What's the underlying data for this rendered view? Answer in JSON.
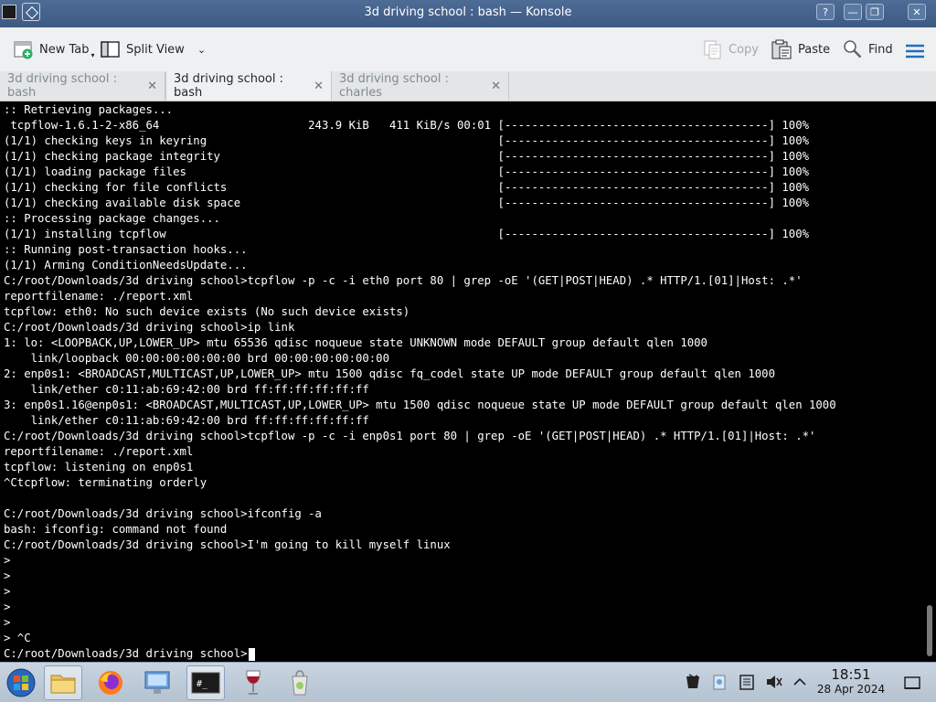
{
  "window": {
    "title": "3d driving school : bash — Konsole"
  },
  "toolbar": {
    "new_tab": "New Tab",
    "split_view": "Split View",
    "copy": "Copy",
    "paste": "Paste",
    "find": "Find"
  },
  "tabs": [
    {
      "label": "3d driving school : bash",
      "active": false
    },
    {
      "label": "3d driving school : bash",
      "active": true
    },
    {
      "label": "3d driving school : charles",
      "active": false
    }
  ],
  "terminal": {
    "lines": [
      ":: Retrieving packages...",
      " tcpflow-1.6.1-2-x86_64                      243.9 KiB   411 KiB/s 00:01 [---------------------------------------] 100%",
      "(1/1) checking keys in keyring                                           [---------------------------------------] 100%",
      "(1/1) checking package integrity                                         [---------------------------------------] 100%",
      "(1/1) loading package files                                              [---------------------------------------] 100%",
      "(1/1) checking for file conflicts                                        [---------------------------------------] 100%",
      "(1/1) checking available disk space                                      [---------------------------------------] 100%",
      ":: Processing package changes...",
      "(1/1) installing tcpflow                                                 [---------------------------------------] 100%",
      ":: Running post-transaction hooks...",
      "(1/1) Arming ConditionNeedsUpdate...",
      "C:/root/Downloads/3d driving school>tcpflow -p -c -i eth0 port 80 | grep -oE '(GET|POST|HEAD) .* HTTP/1.[01]|Host: .*'",
      "reportfilename: ./report.xml",
      "tcpflow: eth0: No such device exists (No such device exists)",
      "C:/root/Downloads/3d driving school>ip link",
      "1: lo: <LOOPBACK,UP,LOWER_UP> mtu 65536 qdisc noqueue state UNKNOWN mode DEFAULT group default qlen 1000",
      "    link/loopback 00:00:00:00:00:00 brd 00:00:00:00:00:00",
      "2: enp0s1: <BROADCAST,MULTICAST,UP,LOWER_UP> mtu 1500 qdisc fq_codel state UP mode DEFAULT group default qlen 1000",
      "    link/ether c0:11:ab:69:42:00 brd ff:ff:ff:ff:ff:ff",
      "3: enp0s1.16@enp0s1: <BROADCAST,MULTICAST,UP,LOWER_UP> mtu 1500 qdisc noqueue state UP mode DEFAULT group default qlen 1000",
      "    link/ether c0:11:ab:69:42:00 brd ff:ff:ff:ff:ff:ff",
      "C:/root/Downloads/3d driving school>tcpflow -p -c -i enp0s1 port 80 | grep -oE '(GET|POST|HEAD) .* HTTP/1.[01]|Host: .*'",
      "reportfilename: ./report.xml",
      "tcpflow: listening on enp0s1",
      "^Ctcpflow: terminating orderly",
      "",
      "C:/root/Downloads/3d driving school>ifconfig -a",
      "bash: ifconfig: command not found",
      "C:/root/Downloads/3d driving school>I'm going to kill myself linux",
      ">",
      ">",
      ">",
      ">",
      ">",
      "> ^C"
    ],
    "prompt": "C:/root/Downloads/3d driving school>"
  },
  "taskbar": {
    "apps": [
      "start-orb",
      "file-manager",
      "firefox",
      "system-settings",
      "terminal",
      "wine",
      "package-manager"
    ],
    "clock_time": "18:51",
    "clock_date": "28 Apr 2024"
  },
  "colors": {
    "titlebar": "#4d6c96",
    "terminal_bg": "#000000",
    "terminal_fg": "#ffffff",
    "accent": "#3daee9"
  }
}
